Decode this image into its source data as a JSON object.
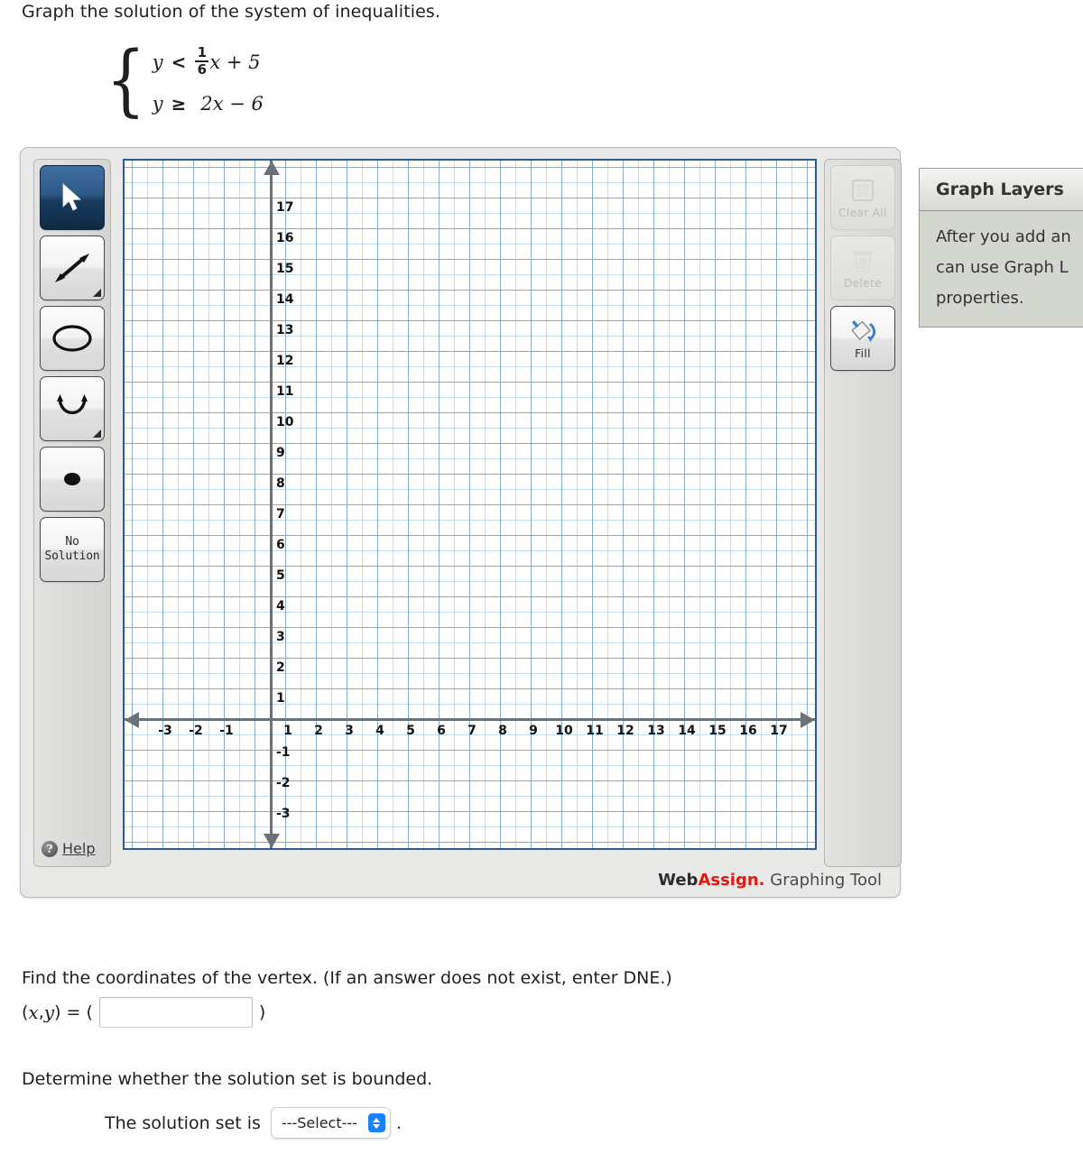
{
  "prompt": "Graph the solution of the system of inequalities.",
  "system": {
    "eq1": {
      "lhs": "y",
      "relation": "<",
      "frac_num": "1",
      "frac_den": "6",
      "rest": "x + 5"
    },
    "eq2": {
      "lhs": "y",
      "relation": "≥",
      "rest": "2x − 6"
    }
  },
  "graph_tool": {
    "left_toolbar": {
      "tools": [
        {
          "name": "select-tool",
          "icon": "cursor-arrow-icon",
          "active": true
        },
        {
          "name": "line-tool",
          "icon": "double-arrow-icon",
          "active": false
        },
        {
          "name": "circle-tool",
          "icon": "ellipse-icon",
          "active": false
        },
        {
          "name": "parabola-tool",
          "icon": "parabola-icon",
          "active": false
        },
        {
          "name": "point-tool",
          "icon": "filled-dot-icon",
          "active": false
        }
      ],
      "no_solution_line1": "No",
      "no_solution_line2": "Solution",
      "help_label": "Help",
      "help_icon": "question-mark-icon"
    },
    "right_toolbar": {
      "clear_all_label": "Clear All",
      "clear_all_icon": "square-icon",
      "delete_label": "Delete",
      "delete_icon": "trash-icon",
      "fill_label": "Fill",
      "fill_icon": "paint-bucket-icon"
    },
    "branding": {
      "web": "Web",
      "assign": "Assign.",
      "tool": " Graphing Tool"
    }
  },
  "layers_panel": {
    "title": "Graph Layers",
    "line1": "After you add an",
    "line2": "can use Graph L",
    "line3": "properties."
  },
  "chart_data": {
    "type": "scatter",
    "title": "",
    "xlabel": "",
    "ylabel": "",
    "xlim": [
      -4,
      18
    ],
    "ylim": [
      -4,
      18
    ],
    "grid": true,
    "legend": null,
    "x_ticks": [
      "-3",
      "-2",
      "-1",
      "1",
      "2",
      "3",
      "4",
      "5",
      "6",
      "7",
      "8",
      "9",
      "10",
      "11",
      "12",
      "13",
      "14",
      "15",
      "16",
      "17"
    ],
    "y_ticks": [
      "17",
      "16",
      "15",
      "14",
      "13",
      "12",
      "11",
      "10",
      "9",
      "8",
      "7",
      "6",
      "5",
      "4",
      "3",
      "2",
      "1",
      "-1",
      "-2",
      "-3"
    ],
    "grid_spacing_units": 1,
    "series": [],
    "annotations": []
  },
  "vertex_question": {
    "text": "Find the coordinates of the vertex. (If an answer does not exist, enter DNE.)",
    "label_open": "(",
    "label_x": "x",
    "label_comma": ", ",
    "label_y": "y",
    "label_eq": ") = (",
    "input_value": "",
    "input_placeholder": "",
    "label_close": ")"
  },
  "bounded_question": {
    "text": "Determine whether the solution set is bounded.",
    "lead": "The solution set is",
    "select_value": "---Select---",
    "period": "."
  }
}
